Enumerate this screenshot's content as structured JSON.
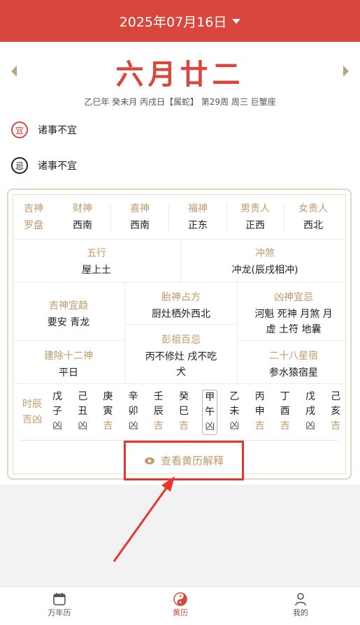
{
  "header": {
    "date": "2025年07月16日"
  },
  "lunar": {
    "day": "六月廿二",
    "ganzhi": "乙巳年 癸未月 丙戌日【属蛇】 第29周 周三 巨蟹座"
  },
  "yi": {
    "badge": "宜",
    "text": "诸事不宜"
  },
  "ji": {
    "badge": "忌",
    "text": "诸事不宜"
  },
  "row1": {
    "left_top": "吉神",
    "left_bottom": "罗盘",
    "items": [
      {
        "label": "财神",
        "value": "西南"
      },
      {
        "label": "喜神",
        "value": "西南"
      },
      {
        "label": "福神",
        "value": "正东"
      },
      {
        "label": "男贵人",
        "value": "正西"
      },
      {
        "label": "女贵人",
        "value": "西北"
      }
    ]
  },
  "wuxing": {
    "label": "五行",
    "value": "屋上土"
  },
  "chongsha": {
    "label": "冲煞",
    "value": "冲龙(辰戌相冲)"
  },
  "jishen": {
    "label": "吉神宜趋",
    "value": "要安 青龙"
  },
  "taishen": {
    "label": "胎神占方",
    "value": "厨灶栖外西北"
  },
  "xiongshen": {
    "label": "凶神宜忌",
    "value1": "河魁 死神 月煞 月",
    "value2": "虚 土符 地囊"
  },
  "jianchu": {
    "label": "建除十二神",
    "value": "平日"
  },
  "pengzu": {
    "label": "彭祖百忌",
    "value1": "丙不修灶 戌不吃",
    "value2": "犬"
  },
  "xingxiu": {
    "label": "二十八星宿",
    "value": "参水猿宿星"
  },
  "hours": {
    "label_top": "时辰",
    "label_bottom": "吉凶",
    "items": [
      {
        "a": "戊",
        "b": "子",
        "c": "凶"
      },
      {
        "a": "己",
        "b": "丑",
        "c": "凶"
      },
      {
        "a": "庚",
        "b": "寅",
        "c": "吉"
      },
      {
        "a": "辛",
        "b": "卯",
        "c": "凶"
      },
      {
        "a": "壬",
        "b": "辰",
        "c": "吉"
      },
      {
        "a": "癸",
        "b": "巳",
        "c": "吉"
      },
      {
        "a": "甲",
        "b": "午",
        "c": "凶"
      },
      {
        "a": "乙",
        "b": "未",
        "c": "凶"
      },
      {
        "a": "丙",
        "b": "申",
        "c": "吉"
      },
      {
        "a": "丁",
        "b": "酉",
        "c": "吉"
      },
      {
        "a": "戊",
        "b": "戌",
        "c": "凶"
      },
      {
        "a": "己",
        "b": "亥",
        "c": "吉"
      }
    ]
  },
  "view_button": "查看黄历解释",
  "tabs": {
    "calendar": "万年历",
    "almanac": "黄历",
    "mine": "我的"
  },
  "colors": {
    "accent": "#d9463e",
    "gold": "#c19a6b"
  }
}
